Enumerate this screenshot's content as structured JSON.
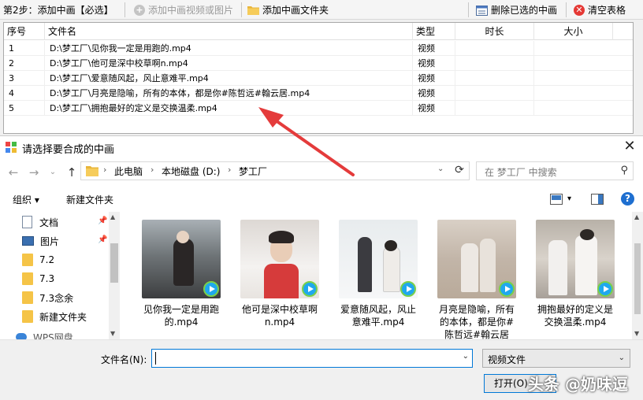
{
  "toolbar": {
    "step_label": "第2步：添加中画【必选】",
    "add_video_label": "添加中画视频或图片",
    "add_folder_label": "添加中画文件夹",
    "delete_selected_label": "删除已选的中画",
    "clear_table_label": "清空表格"
  },
  "table": {
    "headers": {
      "index": "序号",
      "filename": "文件名",
      "type": "类型",
      "duration": "时长",
      "size": "大小"
    },
    "rows": [
      {
        "index": "1",
        "filename": "D:\\梦工厂\\见你我一定是用跑的.mp4",
        "type": "视频"
      },
      {
        "index": "2",
        "filename": "D:\\梦工厂\\他可是深中校草啊n.mp4",
        "type": "视频"
      },
      {
        "index": "3",
        "filename": "D:\\梦工厂\\爱意随风起，风止意难平.mp4",
        "type": "视频"
      },
      {
        "index": "4",
        "filename": "D:\\梦工厂\\月亮是隐喻，所有的本体，都是你#陈哲远#翰云居.mp4",
        "type": "视频"
      },
      {
        "index": "5",
        "filename": "D:\\梦工厂\\拥抱最好的定义是交换温柔.mp4",
        "type": "视频"
      }
    ]
  },
  "dialog": {
    "title": "请选择要合成的中画",
    "address": {
      "root": "此电脑",
      "drive": "本地磁盘 (D:)",
      "folder": "梦工厂"
    },
    "search_placeholder": "在 梦工厂 中搜索",
    "organize_label": "组织 ▾",
    "new_folder_label": "新建文件夹",
    "sidebar": [
      {
        "label": "文档",
        "icon": "document-icon",
        "pinned": true
      },
      {
        "label": "图片",
        "icon": "picture-icon",
        "pinned": true
      },
      {
        "label": "7.2",
        "icon": "folder-icon"
      },
      {
        "label": "7.3",
        "icon": "folder-icon"
      },
      {
        "label": "7.3念余",
        "icon": "folder-icon"
      },
      {
        "label": "新建文件夹",
        "icon": "folder-icon"
      },
      {
        "label": "WPS网盘",
        "icon": "cloud-icon"
      }
    ],
    "files": [
      {
        "label": "见你我一定是用跑的.mp4"
      },
      {
        "label": "他可是深中校草啊n.mp4"
      },
      {
        "label": "爱意随风起，风止意难平.mp4"
      },
      {
        "label": "月亮是隐喻，所有的本体，都是你#陈哲远#翰云居"
      },
      {
        "label": "拥抱最好的定义是交换温柔.mp4"
      }
    ],
    "filename_label": "文件名(N):",
    "filename_value": "",
    "filetype_value": "视频文件",
    "open_label": "打开(O)",
    "watermark": "头条 @奶味逗"
  },
  "colors": {
    "accent": "#0078d7",
    "arrow": "#e43b3b",
    "clear_icon": "#e53935"
  }
}
